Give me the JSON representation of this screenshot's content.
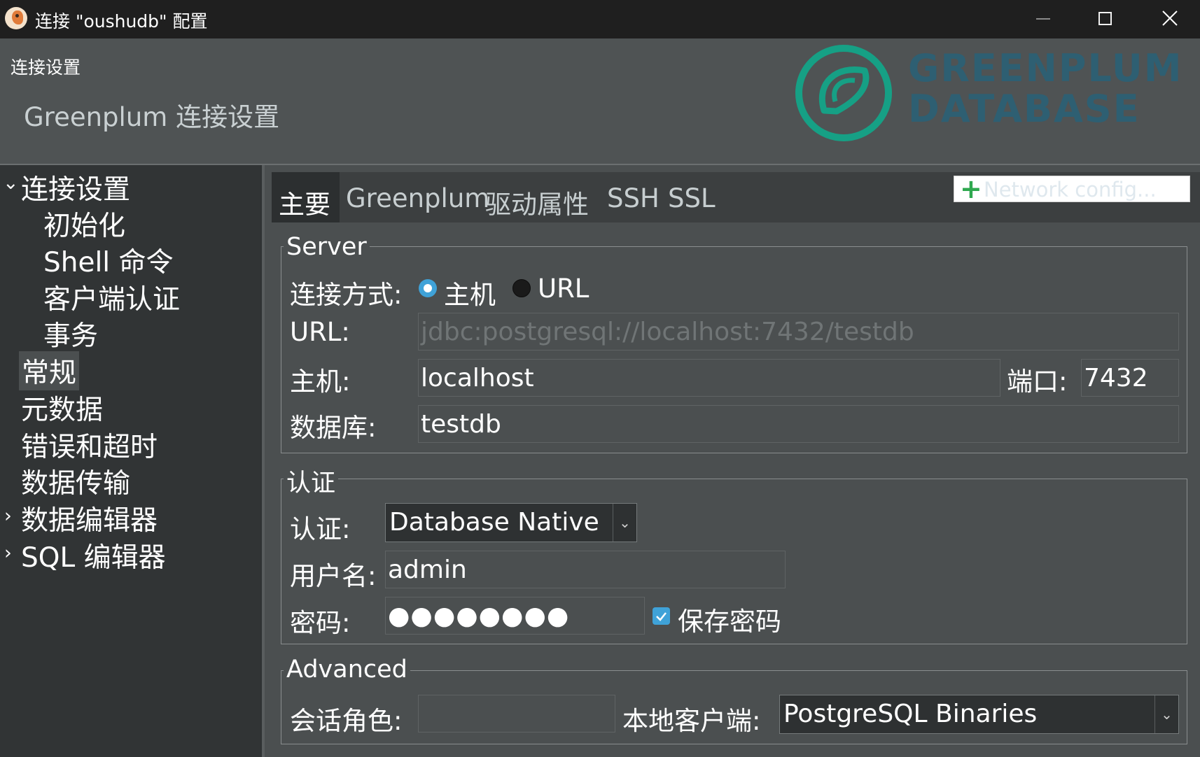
{
  "window": {
    "title": "连接 \"oushudb\" 配置"
  },
  "header": {
    "caption": "连接设置",
    "title": "Greenplum 连接设置",
    "logo_text_line1": "GREENPLUM",
    "logo_text_line2": "DATABASE"
  },
  "sidebar": {
    "items": [
      {
        "label": "连接设置",
        "expanded": true
      },
      {
        "label": "初始化"
      },
      {
        "label": "Shell 命令"
      },
      {
        "label": "客户端认证"
      },
      {
        "label": "事务"
      },
      {
        "label": "常规",
        "selected": true
      },
      {
        "label": "元数据"
      },
      {
        "label": "错误和超时"
      },
      {
        "label": "数据传输"
      },
      {
        "label": "数据编辑器",
        "expanded": false
      },
      {
        "label": "SQL 编辑器",
        "expanded": false
      }
    ]
  },
  "tabs": [
    {
      "label": "主要",
      "active": true
    },
    {
      "label": "Greenplum"
    },
    {
      "label": "驱动属性"
    },
    {
      "label": "SSH"
    },
    {
      "label": "SSL"
    }
  ],
  "network_button": {
    "label": "Network config..."
  },
  "server": {
    "legend": "Server",
    "connect_mode_label": "连接方式:",
    "mode_host": "主机",
    "mode_url": "URL",
    "selected_mode": "主机",
    "url_label": "URL:",
    "url_value": "jdbc:postgresql://localhost:7432/testdb",
    "host_label": "主机:",
    "host_value": "localhost",
    "port_label": "端口:",
    "port_value": "7432",
    "db_label": "数据库:",
    "db_value": "testdb"
  },
  "auth": {
    "legend": "认证",
    "auth_label": "认证:",
    "auth_value": "Database Native",
    "user_label": "用户名:",
    "user_value": "admin",
    "pwd_label": "密码:",
    "pwd_value": "●●●●●●●●",
    "save_pwd_label": "保存密码",
    "save_pwd_checked": true
  },
  "advanced": {
    "legend": "Advanced",
    "role_label": "会话角色:",
    "role_value": "",
    "local_client_label": "本地客户端:",
    "local_client_value": "PostgreSQL Binaries"
  },
  "colors": {
    "accent": "#3fa2d8",
    "logo_green": "#16a085",
    "logo_text": "#2e5f72"
  }
}
